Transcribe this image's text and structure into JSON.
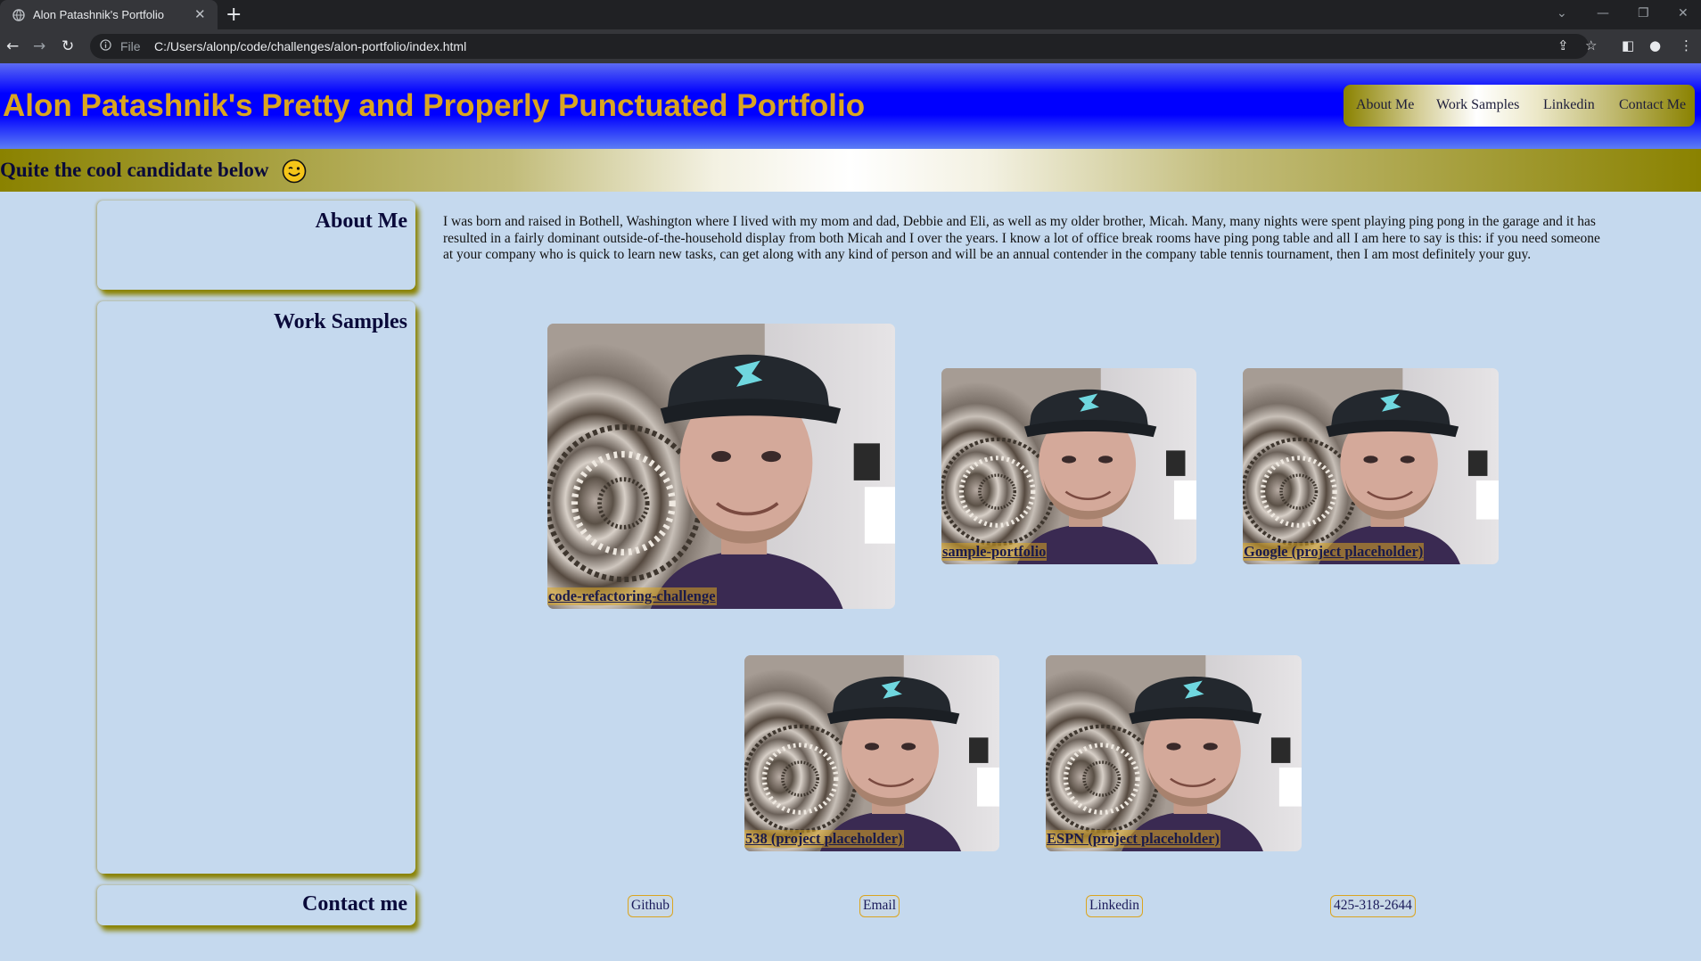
{
  "browser": {
    "tab_title": "Alon Patashnik's Portfolio",
    "tab_close": "✕",
    "new_tab": "+",
    "url_scheme": "File",
    "url": "C:/Users/alonp/code/challenges/alon-portfolio/index.html",
    "icons": [
      "globe-icon",
      "back-icon",
      "forward-icon",
      "reload-icon",
      "info-icon",
      "share-icon",
      "star-icon",
      "sidepanel-icon",
      "profile-icon",
      "menu-icon"
    ]
  },
  "header": {
    "title": "Alon Patashnik's Pretty and Properly Punctuated Portfolio",
    "nav": [
      "About Me",
      "Work Samples",
      "Linkedin",
      "Contact Me"
    ]
  },
  "subheader": {
    "text": "Quite the cool candidate below"
  },
  "sidebar": {
    "about": "About Me",
    "work": "Work Samples",
    "contact": "Contact me"
  },
  "about": {
    "text": "I was born and raised in Bothell, Washington where I lived with my mom and dad, Debbie and Eli, as well as my older brother, Micah. Many, many nights were spent playing ping pong in the garage and it has resulted in a fairly dominant outside-of-the-household display from both Micah and I over the years. I know a lot of office break rooms have ping pong table and all I am here to say is this: if you need someone at your company who is quick to learn new tasks, can get along with any kind of person and will be an annual contender in the company table tennis tournament, then I am most definitely your guy."
  },
  "projects": [
    "code-refactoring-challenge",
    "sample-portfolio",
    "Google (project placeholder)",
    "538 (project placeholder)",
    "ESPN (project placeholder)"
  ],
  "contact": [
    "Github",
    "Email",
    "Linkedin",
    "425-318-2644"
  ],
  "colors": {
    "header_blue": "#0000ff",
    "title_gold": "#daa520",
    "olive": "#8a8200",
    "page_bg": "#c5d9ee"
  }
}
